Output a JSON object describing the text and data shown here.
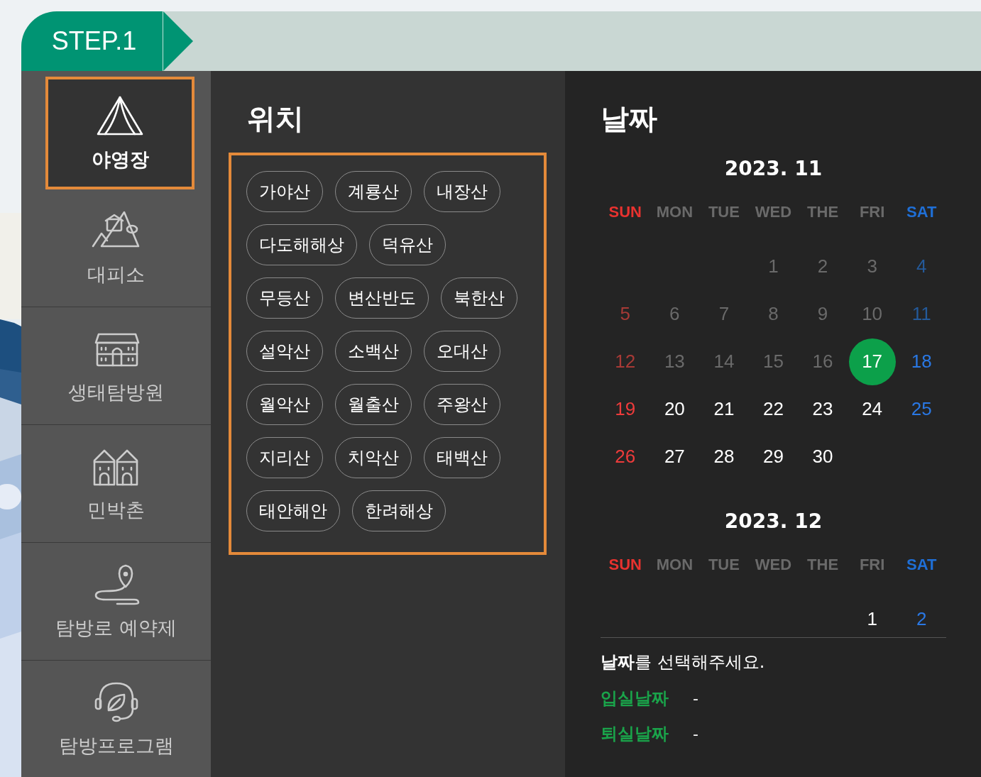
{
  "step": {
    "label": "STEP.1"
  },
  "sidebar": {
    "items": [
      {
        "label": "야영장",
        "kind": "tent",
        "selected": true
      },
      {
        "label": "대피소",
        "kind": "shelter",
        "selected": false
      },
      {
        "label": "생태탐방원",
        "kind": "building",
        "selected": false
      },
      {
        "label": "민박촌",
        "kind": "houses",
        "selected": false
      },
      {
        "label": "탐방로 예약제",
        "kind": "route",
        "selected": false
      },
      {
        "label": "탐방프로그램",
        "kind": "headset",
        "selected": false
      }
    ]
  },
  "location": {
    "title": "위치",
    "chip_rows": [
      [
        {
          "label": "가야산",
          "selected": false
        },
        {
          "label": "계룡산",
          "selected": false
        },
        {
          "label": "내장산",
          "selected": false
        }
      ],
      [
        {
          "label": "다도해해상",
          "selected": false
        },
        {
          "label": "덕유산",
          "selected": false
        }
      ],
      [
        {
          "label": "무등산",
          "selected": false
        },
        {
          "label": "변산반도",
          "selected": false
        },
        {
          "label": "북한산",
          "selected": false
        }
      ],
      [
        {
          "label": "설악산",
          "selected": false
        },
        {
          "label": "소백산",
          "selected": false
        },
        {
          "label": "오대산",
          "selected": false
        }
      ],
      [
        {
          "label": "월악산",
          "selected": false
        },
        {
          "label": "월출산",
          "selected": false
        },
        {
          "label": "주왕산",
          "selected": false
        }
      ],
      [
        {
          "label": "지리산",
          "selected": false
        },
        {
          "label": "치악산",
          "selected": false
        },
        {
          "label": "태백산",
          "selected": false
        }
      ],
      [
        {
          "label": "태안해안",
          "selected": false
        },
        {
          "label": "한려해상",
          "selected": false
        }
      ]
    ]
  },
  "date": {
    "title": "날짜",
    "months": [
      {
        "title": "2023. 11",
        "weekdays": [
          "SUN",
          "MON",
          "TUE",
          "WED",
          "THE",
          "FRI",
          "SAT"
        ],
        "weeks": [
          [
            {
              "kind": "blank"
            },
            {
              "kind": "blank"
            },
            {
              "kind": "blank"
            },
            {
              "kind": "day",
              "day": "1",
              "disabled": true,
              "selected": false
            },
            {
              "kind": "day",
              "day": "2",
              "disabled": true,
              "selected": false
            },
            {
              "kind": "day",
              "day": "3",
              "disabled": true,
              "selected": false
            },
            {
              "kind": "day",
              "day": "4",
              "disabled": true,
              "selected": false
            }
          ],
          [
            {
              "kind": "day",
              "day": "5",
              "disabled": true,
              "selected": false
            },
            {
              "kind": "day",
              "day": "6",
              "disabled": true,
              "selected": false
            },
            {
              "kind": "day",
              "day": "7",
              "disabled": true,
              "selected": false
            },
            {
              "kind": "day",
              "day": "8",
              "disabled": true,
              "selected": false
            },
            {
              "kind": "day",
              "day": "9",
              "disabled": true,
              "selected": false
            },
            {
              "kind": "day",
              "day": "10",
              "disabled": true,
              "selected": false
            },
            {
              "kind": "day",
              "day": "11",
              "disabled": true,
              "selected": false
            }
          ],
          [
            {
              "kind": "day",
              "day": "12",
              "disabled": true,
              "selected": false
            },
            {
              "kind": "day",
              "day": "13",
              "disabled": true,
              "selected": false
            },
            {
              "kind": "day",
              "day": "14",
              "disabled": true,
              "selected": false
            },
            {
              "kind": "day",
              "day": "15",
              "disabled": true,
              "selected": false
            },
            {
              "kind": "day",
              "day": "16",
              "disabled": true,
              "selected": false
            },
            {
              "kind": "day",
              "day": "17",
              "disabled": false,
              "selected": true
            },
            {
              "kind": "day",
              "day": "18",
              "disabled": false,
              "selected": false
            }
          ],
          [
            {
              "kind": "day",
              "day": "19",
              "disabled": false,
              "selected": false
            },
            {
              "kind": "day",
              "day": "20",
              "disabled": false,
              "selected": false
            },
            {
              "kind": "day",
              "day": "21",
              "disabled": false,
              "selected": false
            },
            {
              "kind": "day",
              "day": "22",
              "disabled": false,
              "selected": false
            },
            {
              "kind": "day",
              "day": "23",
              "disabled": false,
              "selected": false
            },
            {
              "kind": "day",
              "day": "24",
              "disabled": false,
              "selected": false
            },
            {
              "kind": "day",
              "day": "25",
              "disabled": false,
              "selected": false
            }
          ],
          [
            {
              "kind": "day",
              "day": "26",
              "disabled": false,
              "selected": false
            },
            {
              "kind": "day",
              "day": "27",
              "disabled": false,
              "selected": false
            },
            {
              "kind": "day",
              "day": "28",
              "disabled": false,
              "selected": false
            },
            {
              "kind": "day",
              "day": "29",
              "disabled": false,
              "selected": false
            },
            {
              "kind": "day",
              "day": "30",
              "disabled": false,
              "selected": false
            },
            {
              "kind": "blank"
            },
            {
              "kind": "blank"
            }
          ]
        ]
      },
      {
        "title": "2023. 12",
        "weekdays": [
          "SUN",
          "MON",
          "TUE",
          "WED",
          "THE",
          "FRI",
          "SAT"
        ],
        "weeks": [
          [
            {
              "kind": "blank"
            },
            {
              "kind": "blank"
            },
            {
              "kind": "blank"
            },
            {
              "kind": "blank"
            },
            {
              "kind": "blank"
            },
            {
              "kind": "day",
              "day": "1",
              "disabled": false,
              "selected": false
            },
            {
              "kind": "day",
              "day": "2",
              "disabled": false,
              "selected": false
            }
          ]
        ]
      }
    ],
    "prompt": "**날짜**를 선택해주세요.",
    "fields": [
      {
        "label": "입실날짜",
        "value": "-"
      },
      {
        "label": "퇴실날짜",
        "value": "-"
      }
    ]
  }
}
